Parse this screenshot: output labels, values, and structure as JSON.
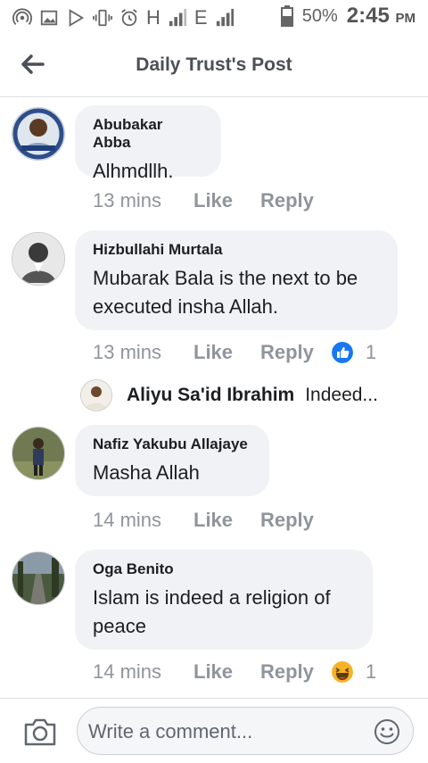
{
  "status_bar": {
    "icons": [
      "wifi-hotspot-icon",
      "image-icon",
      "play-store-icon",
      "vibrate-icon",
      "alarm-icon",
      "signal-h-icon",
      "signal-e-icon"
    ],
    "net1": "H",
    "net2": "E",
    "battery": "50%",
    "time": "2:45",
    "ampm": "PM"
  },
  "header": {
    "title": "Daily Trust's Post"
  },
  "comments": [
    {
      "author": "Abubakar Abba",
      "text": "Alhmdllh.",
      "time": "13 mins",
      "like": "Like",
      "reply": "Reply"
    },
    {
      "author": "Hizbullahi Murtala",
      "text": "Mubarak Bala is the next to be executed insha Allah.",
      "time": "13 mins",
      "like": "Like",
      "reply": "Reply",
      "reaction_count": "1",
      "reaction": "like"
    },
    {
      "author": "Nafiz Yakubu Allajaye",
      "text": "Masha Allah",
      "time": "14 mins",
      "like": "Like",
      "reply": "Reply"
    },
    {
      "author": "Oga Benito",
      "text": "Islam is indeed a religion of peace",
      "time": "14 mins",
      "like": "Like",
      "reply": "Reply",
      "reaction_count": "1",
      "reaction": "haha"
    }
  ],
  "reply_preview": {
    "author": "Aliyu Sa'id Ibrahim",
    "text": "Indeed..."
  },
  "composer": {
    "placeholder": "Write a comment..."
  },
  "colors": {
    "meta": "#90949c",
    "bubble": "#f0f2f5",
    "like_blue": "#1877f2",
    "haha_yellow": "#f7b125"
  }
}
